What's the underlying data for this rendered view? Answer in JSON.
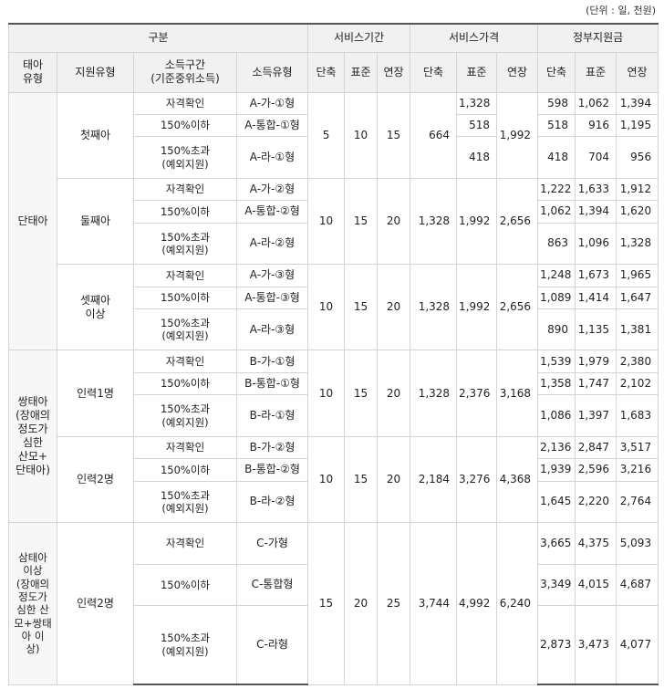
{
  "unit_note": "(단위 : 일, 천원)",
  "header": {
    "group": "구분",
    "service_period": "서비스기간",
    "service_price": "서비스가격",
    "gov_support": "정부지원금",
    "fetus_type": "태아\n유형",
    "support_type": "지원유형",
    "income_range": "소득구간\n(기준중위소득)",
    "income_type": "소득유형",
    "short": "단축",
    "standard": "표준",
    "extended": "연장"
  },
  "groups": [
    {
      "fetus": "단태아",
      "subs": [
        {
          "support": "첫째아",
          "period": [
            "5",
            "10",
            "15"
          ],
          "price_short": "664",
          "price_ext": "1,992",
          "rows": [
            {
              "income": "자격확인",
              "type": "A-가-①형",
              "price_std": "1,328",
              "gov": [
                "598",
                "1,062",
                "1,394"
              ]
            },
            {
              "income": "150%이하",
              "type": "A-통합-①형",
              "price_std": "518",
              "gov": [
                "518",
                "916",
                "1,195"
              ]
            },
            {
              "income": "150%초과\n(예외지원)",
              "type": "A-라-①형",
              "price_std": "418",
              "gov": [
                "418",
                "704",
                "956"
              ]
            }
          ]
        },
        {
          "support": "둘째아",
          "period": [
            "10",
            "15",
            "20"
          ],
          "price": [
            "1,328",
            "1,992",
            "2,656"
          ],
          "rows": [
            {
              "income": "자격확인",
              "type": "A-가-②형",
              "gov": [
                "1,222",
                "1,633",
                "1,912"
              ]
            },
            {
              "income": "150%이하",
              "type": "A-통합-②형",
              "gov": [
                "1,062",
                "1,394",
                "1,620"
              ]
            },
            {
              "income": "150%초과\n(예외지원)",
              "type": "A-라-②형",
              "gov": [
                "863",
                "1,096",
                "1,328"
              ]
            }
          ]
        },
        {
          "support": "셋째아\n이상",
          "period": [
            "10",
            "15",
            "20"
          ],
          "price": [
            "1,328",
            "1,992",
            "2,656"
          ],
          "rows": [
            {
              "income": "자격확인",
              "type": "A-가-③형",
              "gov": [
                "1,248",
                "1,673",
                "1,965"
              ]
            },
            {
              "income": "150%이하",
              "type": "A-통합-③형",
              "gov": [
                "1,089",
                "1,414",
                "1,647"
              ]
            },
            {
              "income": "150%초과\n(예외지원)",
              "type": "A-라-③형",
              "gov": [
                "890",
                "1,135",
                "1,381"
              ]
            }
          ]
        }
      ]
    },
    {
      "fetus": "쌍태아\n(장애의\n정도가\n심한\n산모+\n단태아)",
      "subs": [
        {
          "support": "인력1명",
          "period": [
            "10",
            "15",
            "20"
          ],
          "price": [
            "1,328",
            "2,376",
            "3,168"
          ],
          "rows": [
            {
              "income": "자격확인",
              "type": "B-가-①형",
              "gov": [
                "1,539",
                "1,979",
                "2,380"
              ]
            },
            {
              "income": "150%이하",
              "type": "B-통합-①형",
              "gov": [
                "1,358",
                "1,747",
                "2,102"
              ]
            },
            {
              "income": "150%초과\n(예외지원)",
              "type": "B-라-①형",
              "gov": [
                "1,086",
                "1,397",
                "1,683"
              ]
            }
          ]
        },
        {
          "support": "인력2명",
          "period": [
            "10",
            "15",
            "20"
          ],
          "price": [
            "2,184",
            "3,276",
            "4,368"
          ],
          "rows": [
            {
              "income": "자격확인",
              "type": "B-가-②형",
              "gov": [
                "2,136",
                "2,847",
                "3,517"
              ]
            },
            {
              "income": "150%이하",
              "type": "B-통합-②형",
              "gov": [
                "1,939",
                "2,596",
                "3,216"
              ]
            },
            {
              "income": "150%초과\n(예외지원)",
              "type": "B-라-②형",
              "gov": [
                "1,645",
                "2,220",
                "2,764"
              ]
            }
          ]
        }
      ]
    },
    {
      "fetus": "삼태아\n이상\n(장애의\n정도가\n심한 산\n모+쌍태\n아 이\n상)",
      "subs": [
        {
          "support": "인력2명",
          "period": [
            "15",
            "20",
            "25"
          ],
          "price": [
            "3,744",
            "4,992",
            "6,240"
          ],
          "rows": [
            {
              "income": "자격확인",
              "type": "C-가형",
              "gov": [
                "3,665",
                "4,375",
                "5,093"
              ]
            },
            {
              "income": "150%이하",
              "type": "C-통합형",
              "gov": [
                "3,349",
                "4,015",
                "4,687"
              ]
            },
            {
              "income": "150%초과\n(예외지원)",
              "type": "C-라형",
              "gov": [
                "2,873",
                "3,473",
                "4,077"
              ]
            }
          ]
        }
      ]
    }
  ]
}
